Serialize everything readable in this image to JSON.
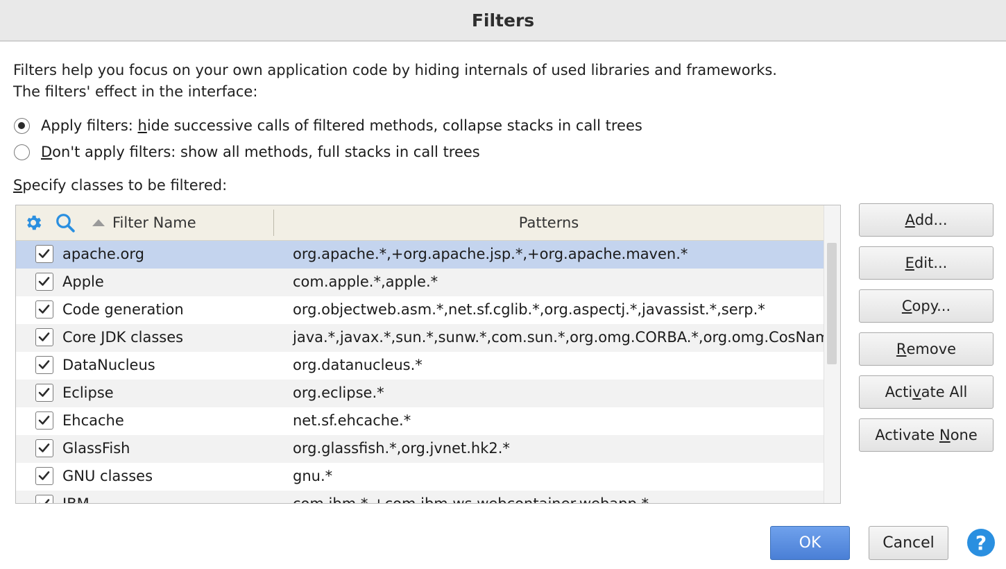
{
  "window": {
    "title": "Filters"
  },
  "description": {
    "line1": "Filters help you focus on your own application code by hiding internals of used libraries and frameworks.",
    "line2": "The filters' effect in the interface:"
  },
  "radio_options": [
    {
      "pre": "Apply filters: ",
      "mnemonic": "h",
      "post": "ide successive calls of filtered methods, collapse stacks in call trees",
      "checked": true
    },
    {
      "pre": "",
      "mnemonic": "D",
      "post": "on't apply filters: show all methods, full stacks in call trees",
      "checked": false
    }
  ],
  "specify_label": {
    "mnemonic": "S",
    "post": "pecify classes to be filtered:"
  },
  "table": {
    "columns": {
      "name": "Filter Name",
      "patterns": "Patterns"
    },
    "toolbar_icons": [
      "gear-icon",
      "search-icon"
    ],
    "sort": "ascending by Filter Name",
    "rows": [
      {
        "name": "apache.org",
        "patterns": "org.apache.*,+org.apache.jsp.*,+org.apache.maven.*",
        "checked": true,
        "selected": true
      },
      {
        "name": "Apple",
        "patterns": "com.apple.*,apple.*",
        "checked": true
      },
      {
        "name": "Code generation",
        "patterns": "org.objectweb.asm.*,net.sf.cglib.*,org.aspectj.*,javassist.*,serp.*",
        "checked": true
      },
      {
        "name": "Core JDK classes",
        "patterns": "java.*,javax.*,sun.*,sunw.*,com.sun.*,org.omg.CORBA.*,org.omg.CosNaming.*",
        "checked": true
      },
      {
        "name": "DataNucleus",
        "patterns": "org.datanucleus.*",
        "checked": true
      },
      {
        "name": "Eclipse",
        "patterns": "org.eclipse.*",
        "checked": true
      },
      {
        "name": "Ehcache",
        "patterns": "net.sf.ehcache.*",
        "checked": true
      },
      {
        "name": "GlassFish",
        "patterns": "org.glassfish.*,org.jvnet.hk2.*",
        "checked": true
      },
      {
        "name": "GNU classes",
        "patterns": "gnu.*",
        "checked": true
      },
      {
        "name": "IBM",
        "patterns": "com.ibm.*,+com.ibm.ws.webcontainer.webapp.*",
        "checked": true
      }
    ]
  },
  "side_buttons": [
    {
      "id": "add",
      "pre": "",
      "mnemonic": "A",
      "post": "dd..."
    },
    {
      "id": "edit",
      "pre": "",
      "mnemonic": "E",
      "post": "dit..."
    },
    {
      "id": "copy",
      "pre": "",
      "mnemonic": "C",
      "post": "opy..."
    },
    {
      "id": "remove",
      "pre": "",
      "mnemonic": "R",
      "post": "emove"
    },
    {
      "id": "activate-all",
      "pre": "Acti",
      "mnemonic": "v",
      "post": "ate All"
    },
    {
      "id": "activate-none",
      "pre": "Activate ",
      "mnemonic": "N",
      "post": "one"
    }
  ],
  "footer": {
    "ok": "OK",
    "cancel": "Cancel",
    "help": "?"
  },
  "colors": {
    "selection": "#c4d4ee",
    "icon_blue": "#2a8fe0",
    "ok_button": "#4a7fd6"
  }
}
